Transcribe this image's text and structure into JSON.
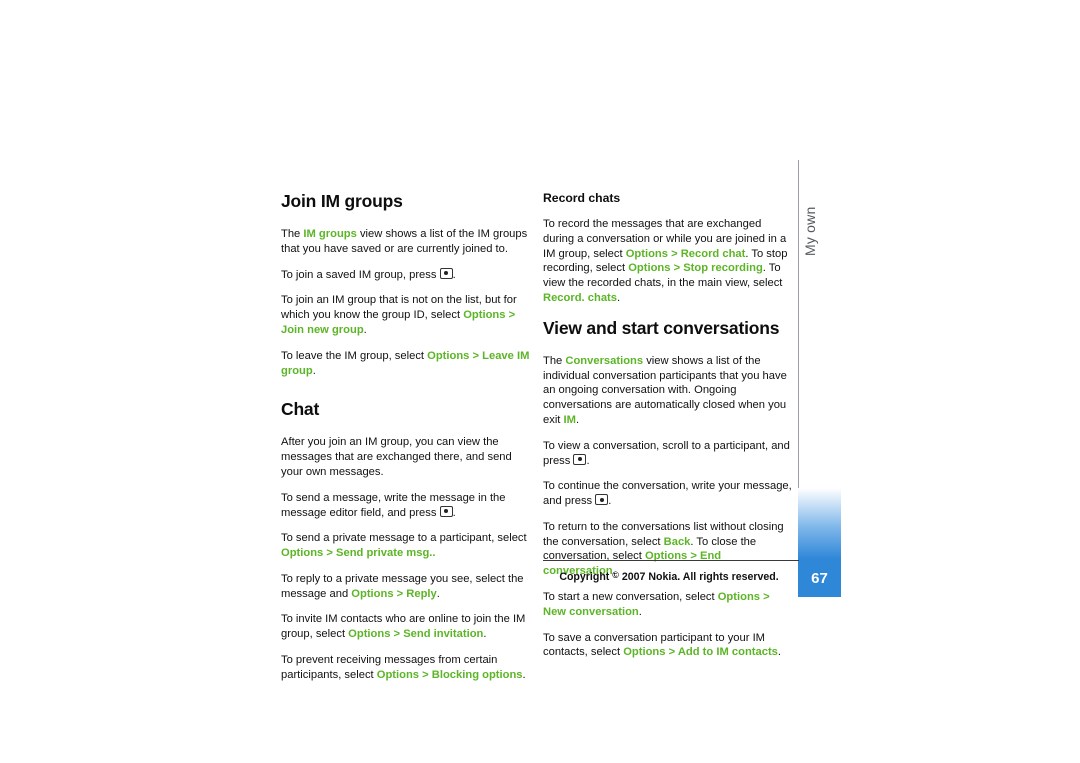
{
  "page": {
    "number": "67",
    "side_tab_label": "My own",
    "footer": {
      "prefix": "Copyright ",
      "symbol": "©",
      "suffix": " 2007 Nokia. All rights reserved."
    },
    "colors": {
      "accent_green": "#5cb526",
      "tab_blue": "#2f87d8",
      "rule_gray": "#9aa0a6"
    }
  },
  "left_column": {
    "heading_join": "Join IM groups",
    "p1_a": "The ",
    "p1_b": "IM groups",
    "p1_c": " view shows a list of the IM groups that you have saved or are currently joined to.",
    "p2_a": "To join a saved IM group, press ",
    "p2_b": ".",
    "p3_a": "To join an IM group that is not on the list, but for which you know the group ID, select ",
    "p3_b": "Options",
    "p3_c": " > ",
    "p3_d": "Join new group",
    "p3_e": ".",
    "p4_a": "To leave the IM group, select ",
    "p4_b": "Options",
    "p4_c": " > ",
    "p4_d": "Leave IM group",
    "p4_e": ".",
    "heading_chat": "Chat",
    "p5": "After you join an IM group, you can view the messages that are exchanged there, and send your own messages.",
    "p6_a": "To send a message, write the message in the message editor field, and press ",
    "p6_b": ".",
    "p7_a": "To send a private message to a participant, select ",
    "p7_b": "Options",
    "p7_c": " > ",
    "p7_d": "Send private msg.",
    "p7_e": ".",
    "p8_a": "To reply to a private message you see, select the message and ",
    "p8_b": "Options",
    "p8_c": " > ",
    "p8_d": "Reply",
    "p8_e": ".",
    "p9_a": "To invite IM contacts who are online to join the IM group, select ",
    "p9_b": "Options",
    "p9_c": " > ",
    "p9_d": "Send invitation",
    "p9_e": ".",
    "p10_a": "To prevent receiving messages from certain participants, select ",
    "p10_b": "Options",
    "p10_c": " > ",
    "p10_d": "Blocking options",
    "p10_e": "."
  },
  "right_column": {
    "heading_record": "Record chats",
    "r1_a": "To record the messages that are exchanged during a conversation or while you are joined in a IM group, select ",
    "r1_b": "Options",
    "r1_c": " > ",
    "r1_d": "Record chat",
    "r1_e": ". To stop recording, select ",
    "r1_f": "Options",
    "r1_g": " > ",
    "r1_h": "Stop recording",
    "r1_i": ". To view the recorded chats, in the main view, select ",
    "r1_j": "Record. chats",
    "r1_k": ".",
    "heading_view": "View and start conversations",
    "r2_a": "The ",
    "r2_b": "Conversations",
    "r2_c": " view shows a list of the individual conversation participants that you have an ongoing conversation with. Ongoing conversations are automatically closed when you exit ",
    "r2_d": "IM",
    "r2_e": ".",
    "r3_a": "To view a conversation, scroll to a participant, and press ",
    "r3_b": ".",
    "r4_a": "To continue the conversation, write your message, and press ",
    "r4_b": ".",
    "r5_a": "To return to the conversations list without closing the conversation, select ",
    "r5_b": "Back",
    "r5_c": ". To close the conversation, select ",
    "r5_d": "Options",
    "r5_e": " > ",
    "r5_f": "End conversation",
    "r5_g": ".",
    "r6_a": "To start a new conversation, select ",
    "r6_b": "Options",
    "r6_c": " > ",
    "r6_d": "New conversation",
    "r6_e": ".",
    "r7_a": "To save a conversation participant to your IM contacts, select ",
    "r7_b": "Options",
    "r7_c": " > ",
    "r7_d": "Add to IM contacts",
    "r7_e": "."
  }
}
